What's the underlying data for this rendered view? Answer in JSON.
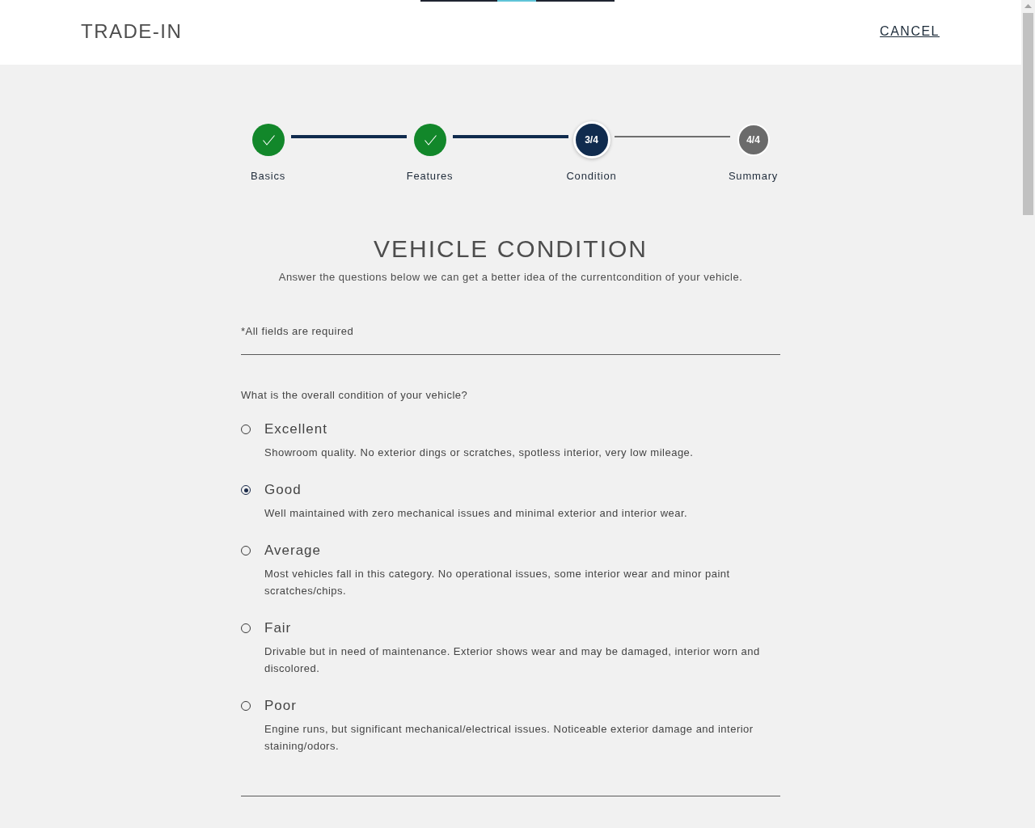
{
  "header": {
    "title": "TRADE-IN",
    "cancel": "CANCEL"
  },
  "steps": [
    {
      "label": "Basics",
      "kind": "done"
    },
    {
      "label": "Features",
      "kind": "done"
    },
    {
      "label": "Condition",
      "kind": "current",
      "number": "3/4"
    },
    {
      "label": "Summary",
      "kind": "upcoming",
      "number": "4/4"
    }
  ],
  "heading": {
    "title": "VEHICLE CONDITION",
    "subtitle": "Answer the questions below we can get a better idea of the currentcondition of your vehicle."
  },
  "required_note": "*All fields are required",
  "question": {
    "text": "What is the overall condition of your vehicle?",
    "options": [
      {
        "label": "Excellent",
        "description": "Showroom quality. No exterior dings or scratches, spotless interior, very low mileage.",
        "selected": false
      },
      {
        "label": "Good",
        "description": "Well maintained with zero mechanical issues and minimal exterior and interior wear.",
        "selected": true
      },
      {
        "label": "Average",
        "description": "Most vehicles fall in this category. No operational issues, some interior wear and minor paint scratches/chips.",
        "selected": false
      },
      {
        "label": "Fair",
        "description": "Drivable but in need of maintenance. Exterior shows wear and may be damaged, interior worn and discolored.",
        "selected": false
      },
      {
        "label": "Poor",
        "description": "Engine runs, but significant mechanical/electrical issues. Noticeable exterior damage and interior staining/odors.",
        "selected": false
      }
    ]
  }
}
